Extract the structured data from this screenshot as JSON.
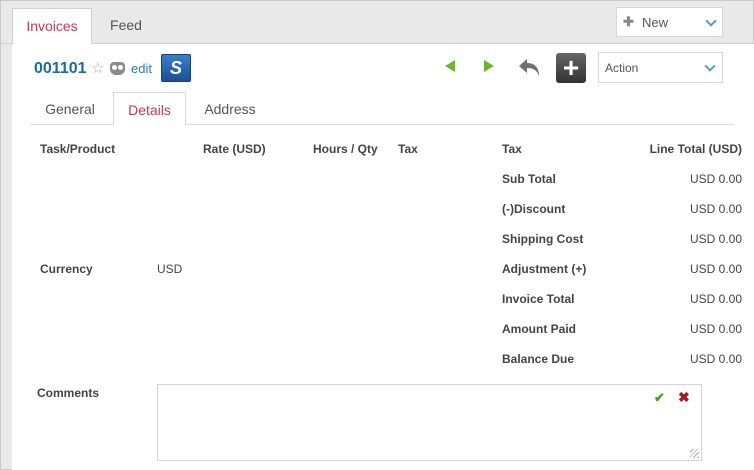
{
  "top_tabs": [
    {
      "label": "Invoices"
    },
    {
      "label": "Feed"
    }
  ],
  "new_menu": {
    "label": "New"
  },
  "record": {
    "number": "001101",
    "edit_label": "edit",
    "brand_glyph": "S"
  },
  "action_menu": {
    "label": "Action"
  },
  "sub_tabs": [
    {
      "label": "General"
    },
    {
      "label": "Details"
    },
    {
      "label": "Address"
    }
  ],
  "columns": {
    "task_product": "Task/Product",
    "rate": "Rate (USD)",
    "hours_qty": "Hours / Qty",
    "tax": "Tax",
    "tax2": "Tax",
    "line_total": "Line Total (USD)"
  },
  "currency": {
    "label": "Currency",
    "value": "USD"
  },
  "summary": [
    {
      "label": "Sub Total",
      "value": "USD 0.00"
    },
    {
      "label": "(-)Discount",
      "value": "USD 0.00"
    },
    {
      "label": "Shipping Cost",
      "value": "USD 0.00"
    },
    {
      "label": "Adjustment (+)",
      "value": "USD 0.00"
    },
    {
      "label": "Invoice Total",
      "value": "USD 0.00"
    },
    {
      "label": "Amount Paid",
      "value": "USD 0.00"
    },
    {
      "label": "Balance Due",
      "value": "USD 0.00"
    }
  ],
  "comments": {
    "label": "Comments",
    "value": ""
  },
  "colors": {
    "accent": "#c23a54",
    "link": "#1d6aa0",
    "nav_arrow": "#6bb531"
  }
}
